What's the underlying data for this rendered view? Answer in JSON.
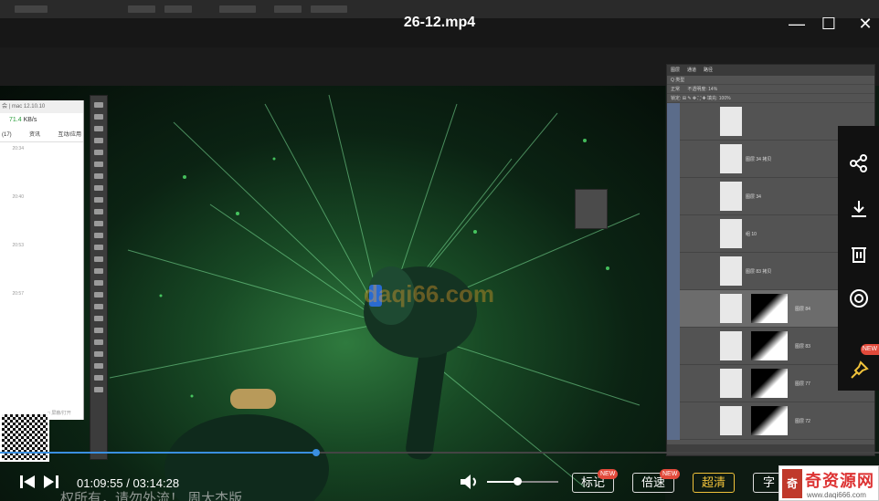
{
  "window": {
    "title": "26-12.mp4",
    "minimize_label": "—",
    "maximize_label": "☐",
    "close_label": "✕"
  },
  "chat_window": {
    "header": "会 | mac 12.10.10",
    "speed_value": "71.4",
    "speed_unit": "KB/s",
    "tabs": [
      "(17)",
      "资讯",
      "互动/应用"
    ],
    "times": [
      "20:34",
      "20:40",
      "20:53",
      "20:57"
    ],
    "footer": "□ 屏蔽/打开"
  },
  "layers_panel": {
    "tabs": [
      "图层",
      "通道",
      "路径"
    ],
    "filter_row": "Q 类型",
    "mode": "正常",
    "opacity": "不透明度: 14%",
    "lock_row": "锁定: ⊞ ✎ ✥ ⛶ ✚  填充: 100%",
    "layers": [
      {
        "name": "",
        "selected": false
      },
      {
        "name": "图层 34 拷贝",
        "selected": false
      },
      {
        "name": "图层 34",
        "selected": false
      },
      {
        "name": "组 10",
        "selected": false
      },
      {
        "name": "图层 83 拷贝",
        "selected": false
      },
      {
        "name": "图层 84",
        "selected": true
      },
      {
        "name": "图层 83",
        "selected": false
      },
      {
        "name": "图层 77",
        "selected": false
      },
      {
        "name": "图层 72",
        "selected": false
      }
    ]
  },
  "watermark": "daqi66.com",
  "sidebar": {
    "share_icon": "share-icon",
    "download_icon": "download-icon",
    "delete_icon": "trash-icon",
    "view_icon": "eye-ring-icon",
    "pin_icon": "pin-icon",
    "pin_badge": "NEW"
  },
  "controls": {
    "current_time": "01:09:55",
    "total_time": "03:14:28",
    "time_separator": " / ",
    "progress_fraction": 0.36,
    "volume_fraction": 0.42,
    "mark_label": "标记",
    "mark_badge": "NEW",
    "speed_label": "倍速",
    "speed_badge": "NEW",
    "quality_label": "超清",
    "subtitle_label": "字"
  },
  "subtitle_text": "权所有，请勿外流！ 周大杰版",
  "site_badge": {
    "logo": "奇",
    "name": "奇资源网",
    "url": "www.daqi666.com"
  },
  "colors": {
    "accent_blue": "#3a8fe0",
    "quality_active": "#f0c23a",
    "badge_red": "#e24a3b"
  }
}
